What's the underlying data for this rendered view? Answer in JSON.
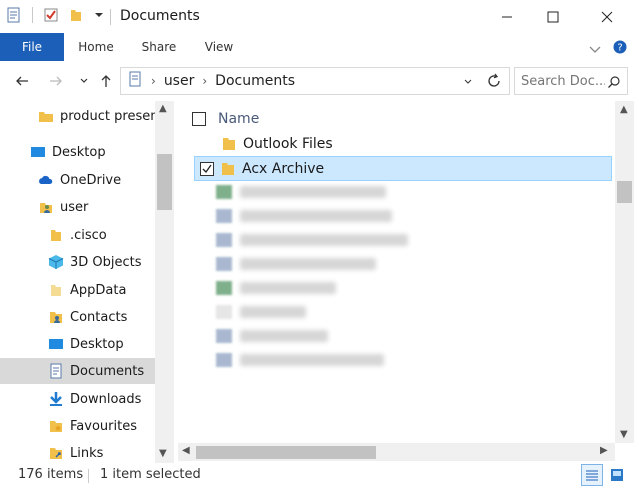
{
  "window": {
    "title": "Documents"
  },
  "ribbon": {
    "tabs": [
      "File",
      "Home",
      "Share",
      "View"
    ]
  },
  "address": {
    "segments": [
      "user",
      "Documents"
    ],
    "search_placeholder": "Search Doc..."
  },
  "nav": {
    "items": [
      {
        "label": "product present",
        "icon": "folder-icon"
      },
      {
        "label": "Desktop",
        "icon": "desktop-icon"
      },
      {
        "label": "OneDrive",
        "icon": "onedrive-cloud-icon"
      },
      {
        "label": "user",
        "icon": "user-folder-icon"
      },
      {
        "label": ".cisco",
        "icon": "folder-icon"
      },
      {
        "label": "3D Objects",
        "icon": "3d-objects-icon"
      },
      {
        "label": "AppData",
        "icon": "folder-icon"
      },
      {
        "label": "Contacts",
        "icon": "contacts-icon"
      },
      {
        "label": "Desktop",
        "icon": "desktop-icon"
      },
      {
        "label": "Documents",
        "icon": "documents-icon"
      },
      {
        "label": "Downloads",
        "icon": "downloads-icon"
      },
      {
        "label": "Favourites",
        "icon": "favourites-icon"
      },
      {
        "label": "Links",
        "icon": "links-icon"
      }
    ],
    "selected_index": 9
  },
  "content": {
    "column_header": "Name",
    "rows": [
      {
        "name": "Outlook Files",
        "selected": false
      },
      {
        "name": "Acx Archive",
        "selected": true
      }
    ]
  },
  "status": {
    "item_count": "176 items",
    "selection": "1 item selected"
  },
  "colors": {
    "accent": "#1c5fb8",
    "selection_bg": "#cce8ff",
    "selection_border": "#99d1ff",
    "folder": "#f0c04a"
  }
}
